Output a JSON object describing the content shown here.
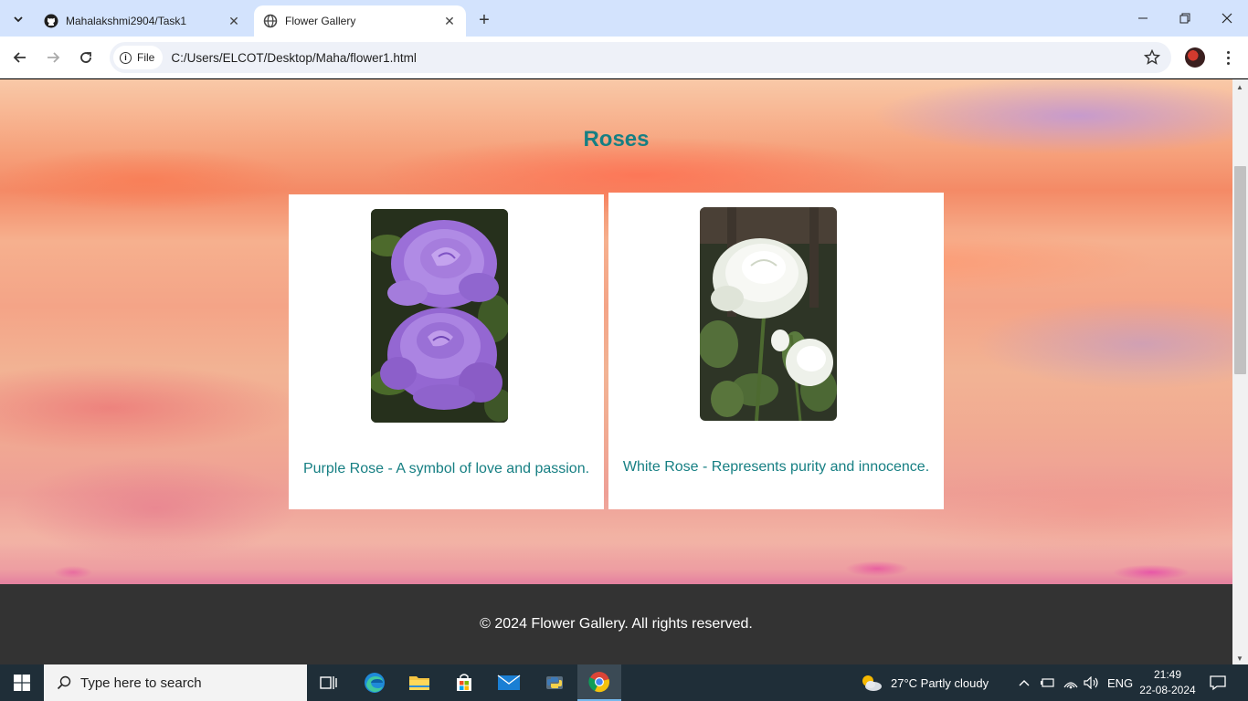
{
  "browser": {
    "tabs": [
      {
        "title": "Mahalakshmi2904/Task1",
        "active": false
      },
      {
        "title": "Flower Gallery",
        "active": true
      }
    ],
    "address_chip": "File",
    "url": "C:/Users/ELCOT/Desktop/Maha/flower1.html"
  },
  "page": {
    "title": "Roses",
    "cards": [
      {
        "caption": "Purple Rose - A symbol of love and passion."
      },
      {
        "caption": "White Rose - Represents purity and innocence."
      }
    ],
    "footer": "© 2024 Flower Gallery. All rights reserved."
  },
  "taskbar": {
    "search_placeholder": "Type here to search",
    "weather": "27°C  Partly cloudy",
    "language": "ENG",
    "time": "21:49",
    "date": "22-08-2024"
  },
  "colors": {
    "accent_teal": "#167f83",
    "footer_bg": "#333333",
    "tabstrip_bg": "#d3e3fd"
  }
}
